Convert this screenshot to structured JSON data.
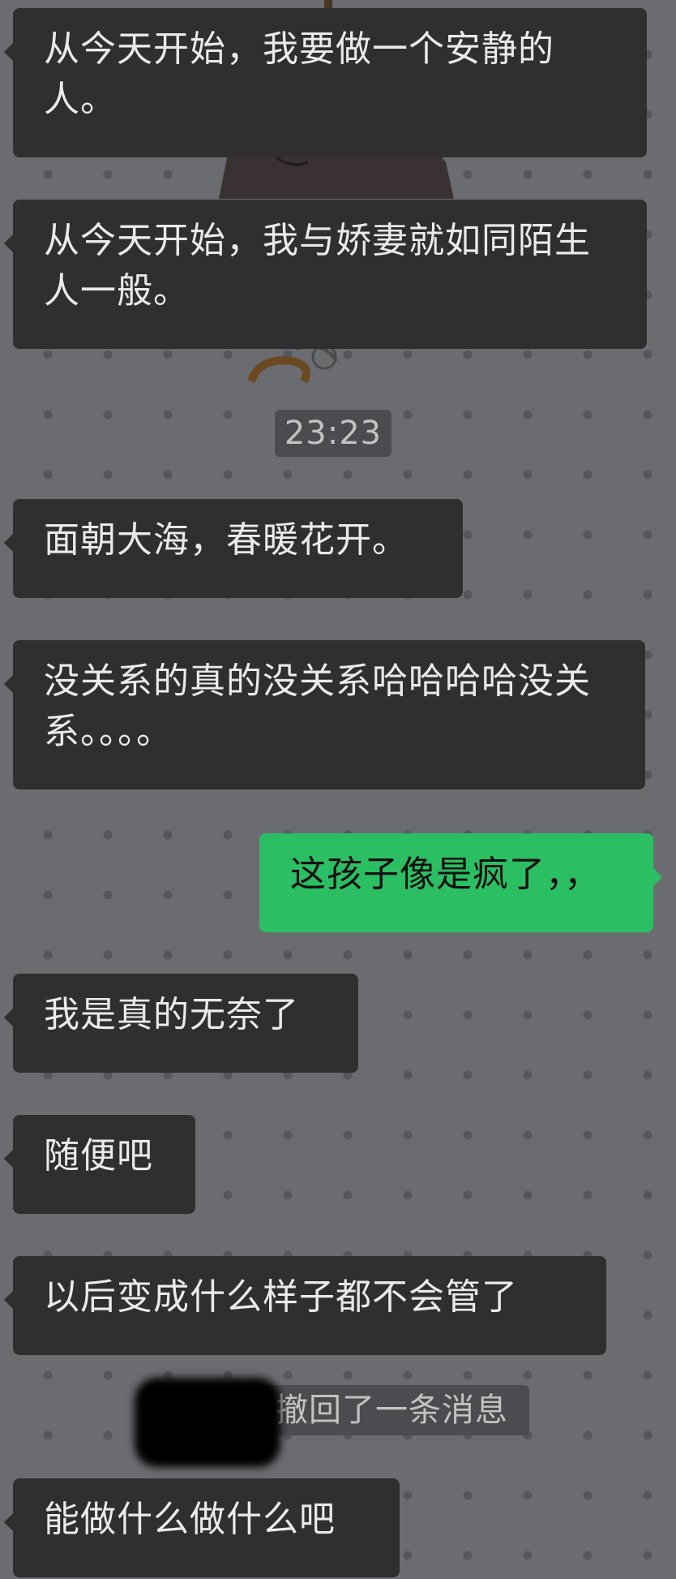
{
  "chat": {
    "messages": [
      {
        "side": "in",
        "text": "从今天开始，我要做一个安静的人。"
      },
      {
        "side": "in",
        "text": "从今天开始，我与娇妻就如同陌生人一般。"
      },
      {
        "side": "in",
        "text": "面朝大海，春暖花开。"
      },
      {
        "side": "in",
        "text": "没关系的真的没关系哈哈哈哈没关系。。。。"
      },
      {
        "side": "out",
        "text": "这孩子像是疯了，，"
      },
      {
        "side": "in",
        "text": "我是真的无奈了"
      },
      {
        "side": "in",
        "text": "随便吧"
      },
      {
        "side": "in",
        "text": "以后变成什么样子都不会管了"
      },
      {
        "side": "in",
        "text": "能做什么做什么吧"
      }
    ],
    "timestamp": "23:23",
    "recall_notice": "撤回了一条消息"
  },
  "colors": {
    "background": "#6a6c70",
    "incoming_bubble": "#2f2f2f",
    "outgoing_bubble": "#2cbe63",
    "incoming_text": "#eaeaea",
    "outgoing_text": "#111111"
  }
}
